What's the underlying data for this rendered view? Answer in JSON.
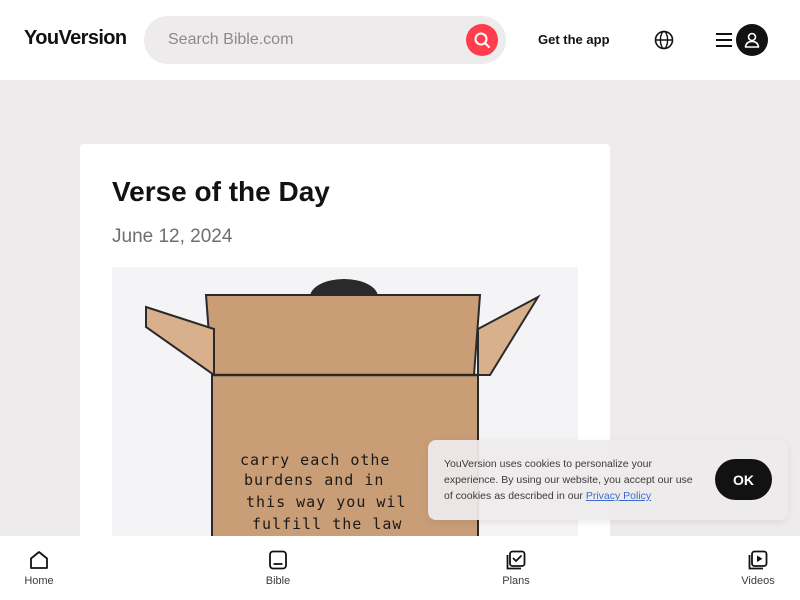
{
  "header": {
    "logo": "YouVersion",
    "search_placeholder": "Search Bible.com",
    "get_app": "Get the app",
    "icons": [
      "search-icon",
      "globe-icon",
      "menu-icon",
      "user-icon"
    ]
  },
  "verse": {
    "title": "Verse of the Day",
    "date": "June 12, 2024",
    "image_text": [
      "carry each othe",
      "burdens and in",
      "this way you wil",
      "fulfill the law"
    ]
  },
  "cookie": {
    "text_before": "YouVersion uses cookies to personalize your experience. By using our website, you accept our use of cookies as described in our ",
    "link": "Privacy Policy",
    "ok": "OK"
  },
  "nav": {
    "items": [
      {
        "label": "Home",
        "icon": "home-icon"
      },
      {
        "label": "Bible",
        "icon": "bible-icon"
      },
      {
        "label": "Plans",
        "icon": "plans-icon"
      },
      {
        "label": "Videos",
        "icon": "videos-icon"
      }
    ]
  },
  "colors": {
    "accent": "#ff3d4d",
    "page_bg": "#edebec",
    "dark": "#121212",
    "link": "#3b6ecb",
    "box": "#c99d76"
  }
}
